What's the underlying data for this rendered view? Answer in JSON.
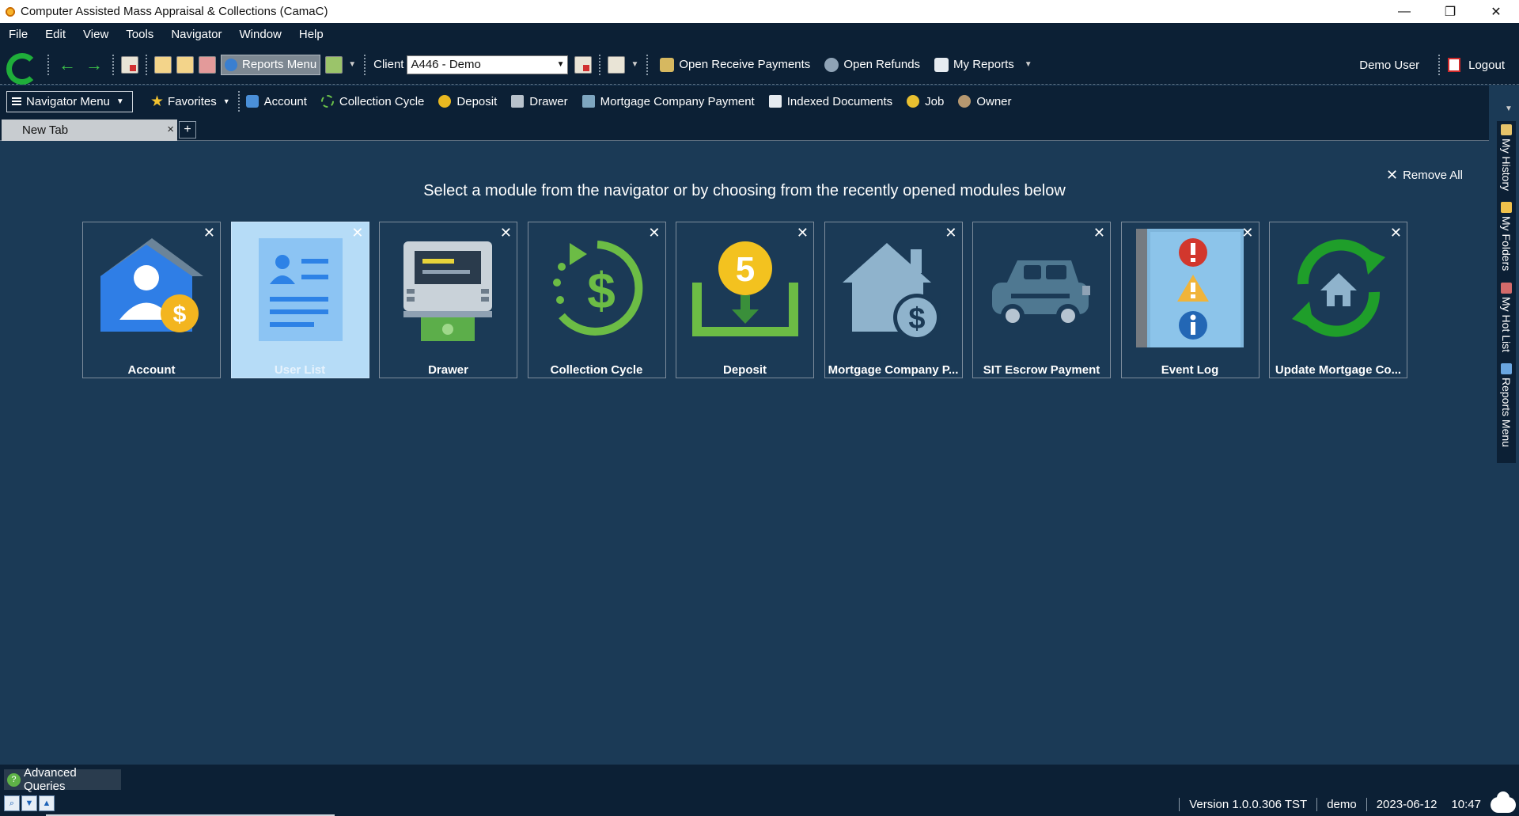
{
  "window": {
    "title": "Computer Assisted Mass Appraisal & Collections (CamaC)",
    "minimize": "—",
    "restore": "❐",
    "close": "✕"
  },
  "menubar": [
    "File",
    "Edit",
    "View",
    "Tools",
    "Navigator",
    "Window",
    "Help"
  ],
  "toolbar": {
    "reports_menu_label": "Reports Menu",
    "client_label": "Client",
    "client_value": "A446 - Demo",
    "links": [
      "Open Receive Payments",
      "Open Refunds",
      "My Reports"
    ],
    "user_name": "Demo User",
    "logout_label": "Logout"
  },
  "navigator": {
    "menu_label": "Navigator Menu",
    "favorites_label": "Favorites",
    "items": [
      "Account",
      "Collection Cycle",
      "Deposit",
      "Drawer",
      "Mortgage Company Payment",
      "Indexed Documents",
      "Job",
      "Owner"
    ]
  },
  "tabs": [
    {
      "label": "New Tab",
      "close": "×"
    }
  ],
  "tab_add": "+",
  "main": {
    "instruction": "Select a module from the navigator or by choosing from the recently opened modules below",
    "remove_all_label": "Remove All",
    "remove_all_x": "✕",
    "cards": [
      {
        "label": "Account",
        "icon": "account-icon",
        "selected": false
      },
      {
        "label": "User List",
        "icon": "user-list-icon",
        "selected": true
      },
      {
        "label": "Drawer",
        "icon": "drawer-icon",
        "selected": false
      },
      {
        "label": "Collection Cycle",
        "icon": "collection-cycle-icon",
        "selected": false
      },
      {
        "label": "Deposit",
        "icon": "deposit-icon",
        "selected": false
      },
      {
        "label": "Mortgage Company P...",
        "icon": "mortgage-house-icon",
        "selected": false
      },
      {
        "label": "SIT Escrow Payment",
        "icon": "car-icon",
        "selected": false
      },
      {
        "label": "Event Log",
        "icon": "event-log-icon",
        "selected": false
      },
      {
        "label": "Update Mortgage Co...",
        "icon": "update-mortgage-icon",
        "selected": false
      }
    ],
    "card_close": "✕",
    "deposit_coin_text": "5",
    "dollar_sign": "$"
  },
  "side_panel": [
    "My History",
    "My Folders",
    "My Hot List",
    "Reports Menu"
  ],
  "bottom": {
    "advanced_queries_label": "Advanced Queries",
    "version": "Version 1.0.0.306 TST",
    "user": "demo",
    "date": "2023-06-12",
    "time": "10:47"
  },
  "colors": {
    "background": "#1b3a56",
    "bars": "#0c2035",
    "selected_card": "#b6dcf7",
    "accent_green": "#1fae3a"
  }
}
